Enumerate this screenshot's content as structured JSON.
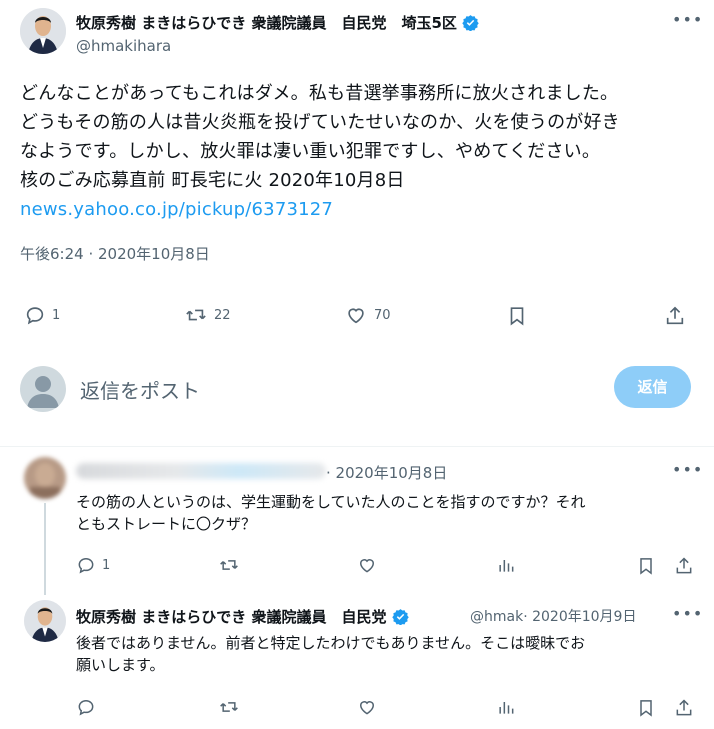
{
  "main_tweet": {
    "author_name": "牧原秀樹 まきはらひでき 衆議院議員　自民党　埼玉5区",
    "handle": "@hmakihara",
    "lines": [
      "どんなことがあってもこれはダメ。私も昔選挙事務所に放火されました。",
      "どうもその筋の人は昔火炎瓶を投げていたせいなのか、火を使うのが好き",
      "なようです。しかし、放火罪は凄い重い犯罪ですし、やめてください。",
      "核のごみ応募直前 町長宅に火 2020年10月8日"
    ],
    "link": "news.yahoo.co.jp/pickup/6373127",
    "timestamp": "午後6:24 · 2020年10月8日",
    "replies": "1",
    "retweets": "22",
    "likes": "70"
  },
  "reply_box": {
    "placeholder": "返信をポスト",
    "button": "返信"
  },
  "reply1": {
    "date": "· 2020年10月8日",
    "lines": [
      "その筋の人というのは、学生運動をしていた人のことを指すのですか？それ",
      "ともストレートに〇クザ？"
    ],
    "replies": "1"
  },
  "reply2": {
    "author_name": "牧原秀樹 まきはらひでき 衆議院議員　自民党",
    "handle_date": "@hmak· 2020年10月9日",
    "lines": [
      "後者ではありません。前者と特定したわけでもありません。そこは曖昧でお",
      "願いします。"
    ]
  },
  "colors": {
    "accent": "#1d9bf0",
    "muted": "#536471",
    "reply_button": "#8ecdf8"
  }
}
